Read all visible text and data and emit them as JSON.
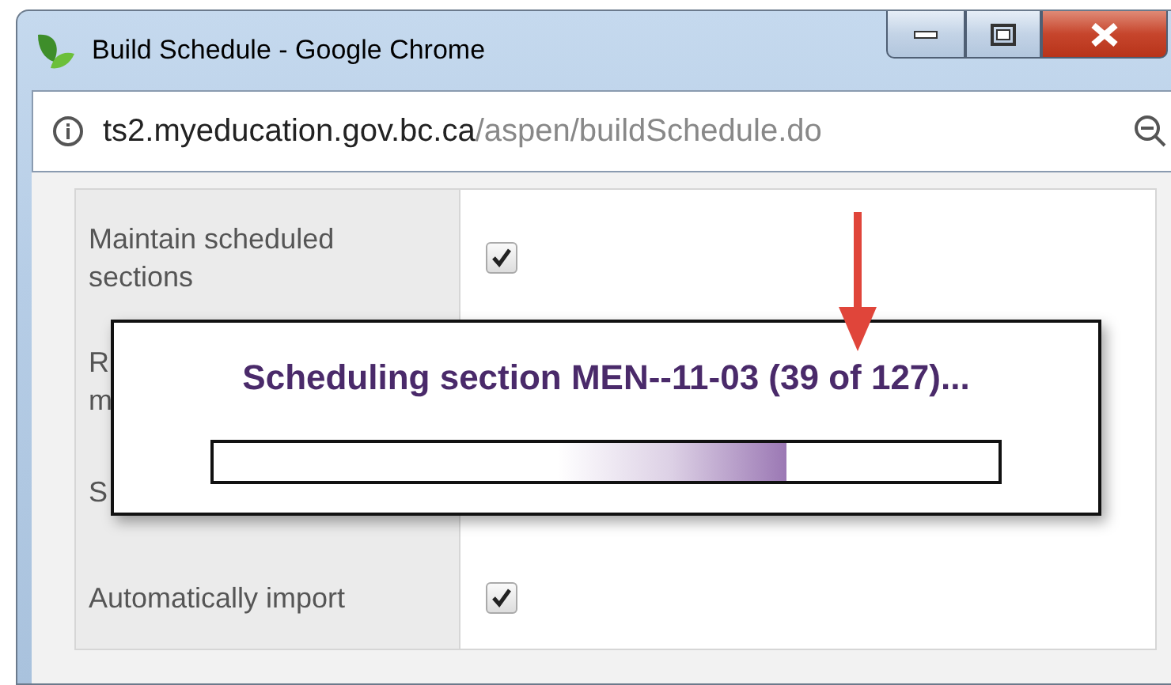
{
  "window": {
    "title": "Build Schedule - Google Chrome"
  },
  "address_bar": {
    "host": "ts2.myeducation.gov.bc.ca",
    "path": "/aspen/buildSchedule.do"
  },
  "options": [
    {
      "lines": [
        "Maintain scheduled",
        "sections"
      ],
      "kind": "checkbox",
      "checked": true
    },
    {
      "lines": [
        "R",
        "m"
      ],
      "kind": "hidden"
    },
    {
      "lines": [
        "S"
      ],
      "kind": "hidden"
    },
    {
      "lines": [
        "Automatically import"
      ],
      "kind": "checkbox",
      "checked": true
    }
  ],
  "progress_dialog": {
    "message": "Scheduling section MEN--11-03 (39 of 127)...",
    "level": 0.73
  }
}
